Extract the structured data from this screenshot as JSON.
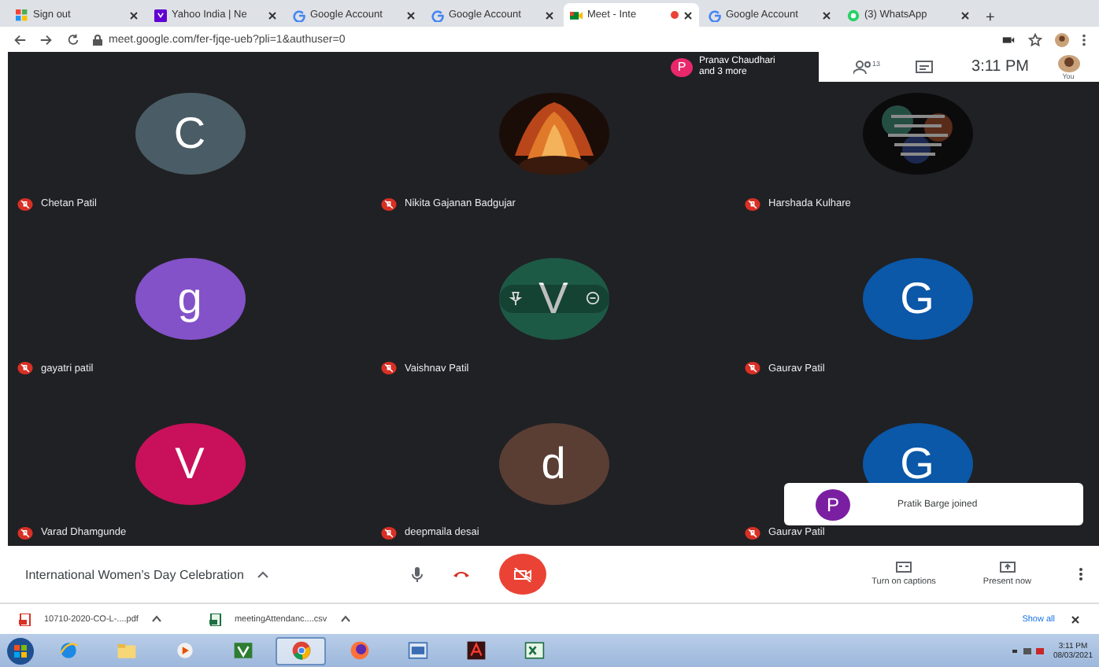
{
  "browser": {
    "tabs": [
      {
        "kind": "grid",
        "title": "Sign out",
        "selected": false
      },
      {
        "kind": "yahoo",
        "title": "Yahoo India | Ne",
        "selected": false
      },
      {
        "kind": "google",
        "title": "Google Account",
        "selected": false
      },
      {
        "kind": "google",
        "title": "Google Account",
        "selected": false
      },
      {
        "kind": "meet",
        "title": "Meet - Inte",
        "selected": true,
        "recording": true
      },
      {
        "kind": "google",
        "title": "Google Account",
        "selected": false
      },
      {
        "kind": "whatsapp",
        "title": "(3) WhatsApp",
        "selected": false
      }
    ],
    "new_tab": "+",
    "url": "meet.google.com/fer-fjqe-ueb?pli=1&authuser=0"
  },
  "meeting": {
    "participants": [
      {
        "name": "Chetan Patil",
        "kind": "letter",
        "letter": "C",
        "color": "#4a5d66",
        "muted": true,
        "hovered": false
      },
      {
        "name": "Nikita Gajanan Badgujar",
        "kind": "picture",
        "muted": true,
        "hovered": false
      },
      {
        "name": "Harshada Kulhare",
        "kind": "picture",
        "muted": true,
        "hovered": false
      },
      {
        "name": "gayatri patil",
        "kind": "letter",
        "letter": "g",
        "color": "#8352c9",
        "muted": true,
        "hovered": false
      },
      {
        "name": "Vaishnav Patil",
        "kind": "letter",
        "letter": "V",
        "color": "#1d5a45",
        "muted": true,
        "hovered": true
      },
      {
        "name": "Gaurav Patil",
        "kind": "letter",
        "letter": "G",
        "color": "#0b57a8",
        "muted": true,
        "hovered": false
      },
      {
        "name": "Varad Dhamgunde",
        "kind": "letter",
        "letter": "V",
        "color": "#c8115a",
        "muted": true,
        "hovered": false
      },
      {
        "name": "deepmaila desai",
        "kind": "letter",
        "letter": "d",
        "color": "#5a3e34",
        "muted": true,
        "hovered": false
      },
      {
        "name": "Gaurav Patil",
        "kind": "letter",
        "letter": "G",
        "color": "#0b57a8",
        "muted": true,
        "hovered": false
      }
    ],
    "presence": {
      "initial": "P",
      "color": "#e9286b",
      "line1": "Pranav Chaudhari",
      "line2": "and 3 more"
    },
    "people_count": "13",
    "time": "3:11 PM",
    "self_label": "You",
    "toast": {
      "initial": "P",
      "color": "#7b1fa2",
      "text": "Pratik Barge joined"
    }
  },
  "controls": {
    "title": "International Women’s Day Celebration",
    "camera_off": true,
    "captions": "Turn on captions",
    "present": "Present now"
  },
  "downloads": {
    "files": [
      {
        "kind": "pdf",
        "name": "10710-2020-CO-L-....pdf"
      },
      {
        "kind": "csv",
        "name": "meetingAttendanc....csv"
      }
    ],
    "show_all": "Show all"
  },
  "taskbar": {
    "apps": [
      {
        "kind": "ie",
        "selected": false
      },
      {
        "kind": "folder",
        "selected": false
      },
      {
        "kind": "media",
        "selected": false
      },
      {
        "kind": "vnote",
        "selected": false
      },
      {
        "kind": "chrome",
        "selected": true
      },
      {
        "kind": "firefox",
        "selected": false
      },
      {
        "kind": "window",
        "selected": false
      },
      {
        "kind": "acrobat",
        "selected": false
      },
      {
        "kind": "excel",
        "selected": false
      }
    ],
    "time": "3:11 PM",
    "date": "08/03/2021"
  }
}
